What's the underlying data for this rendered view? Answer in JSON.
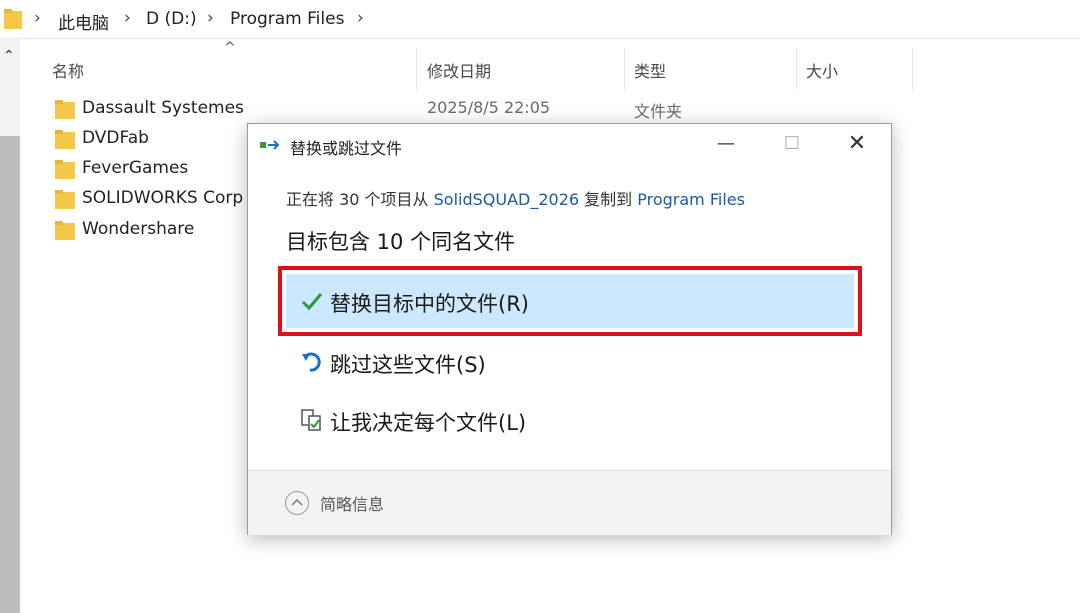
{
  "breadcrumb": [
    "此电脑",
    "D (D:)",
    "Program Files"
  ],
  "columns": {
    "name": "名称",
    "modified": "修改日期",
    "type": "类型",
    "size": "大小"
  },
  "files": [
    {
      "name": "Dassault Systemes",
      "date": "2025/8/5 22:05",
      "type": "文件夹"
    },
    {
      "name": "DVDFab",
      "date": "",
      "type": ""
    },
    {
      "name": "FeverGames",
      "date": "",
      "type": ""
    },
    {
      "name": "SOLIDWORKS Corp",
      "date": "",
      "type": ""
    },
    {
      "name": "Wondershare",
      "date": "",
      "type": ""
    }
  ],
  "dialog": {
    "title": "替换或跳过文件",
    "info_prefix": "正在将 30 个项目从 ",
    "source": "SolidSQUAD_2026",
    "info_mid": " 复制到 ",
    "destination": "Program Files",
    "subheading": "目标包含 10 个同名文件",
    "options": {
      "replace": "替换目标中的文件(R)",
      "skip": "跳过这些文件(S)",
      "decide": "让我决定每个文件(L)"
    },
    "footer": "简略信息"
  },
  "colors": {
    "highlight": "#cce8ff",
    "red_outline": "#e0101a",
    "link": "#1a5aa6",
    "folder": "#f6c84a"
  }
}
